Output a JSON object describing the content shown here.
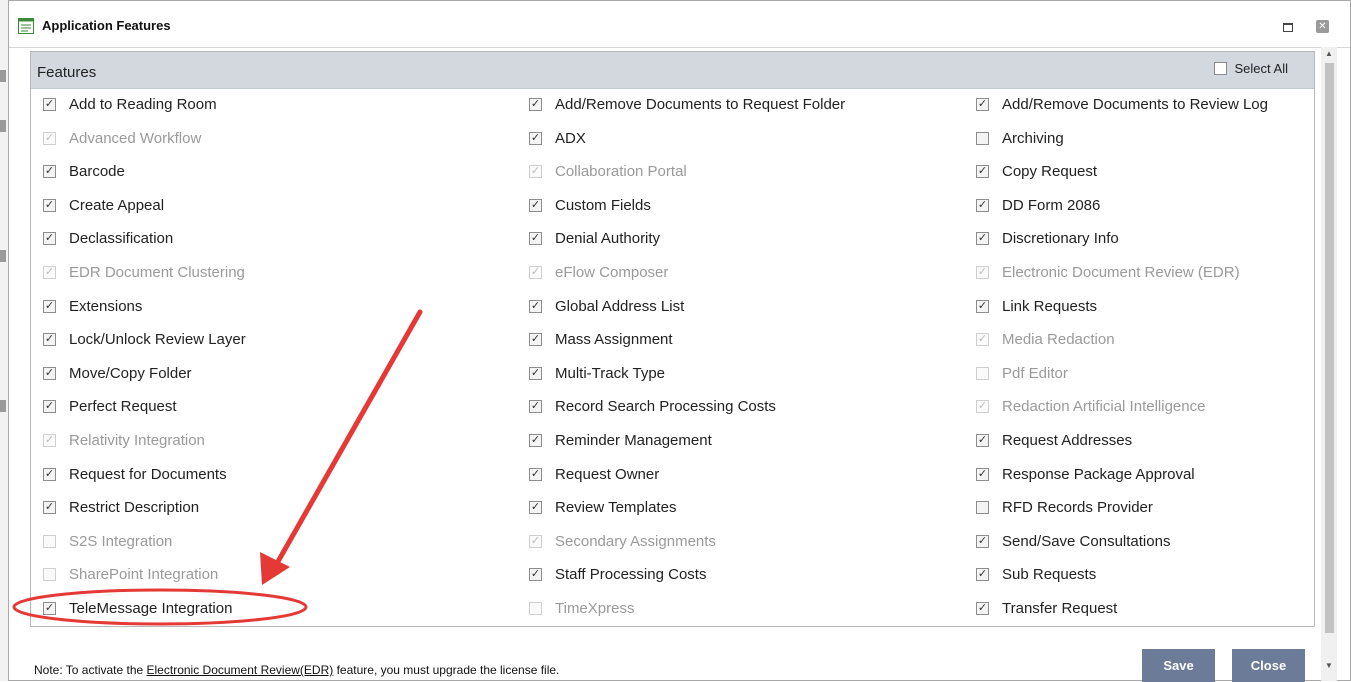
{
  "window": {
    "title": "Application Features"
  },
  "panel": {
    "header": "Features",
    "select_all_label": "Select All"
  },
  "features": {
    "col1": [
      {
        "label": "Add to Reading Room",
        "checked": true,
        "enabled": true
      },
      {
        "label": "Advanced Workflow",
        "checked": true,
        "enabled": false
      },
      {
        "label": "Barcode",
        "checked": true,
        "enabled": true
      },
      {
        "label": "Create Appeal",
        "checked": true,
        "enabled": true
      },
      {
        "label": "Declassification",
        "checked": true,
        "enabled": true
      },
      {
        "label": "EDR Document Clustering",
        "checked": true,
        "enabled": false
      },
      {
        "label": "Extensions",
        "checked": true,
        "enabled": true
      },
      {
        "label": "Lock/Unlock Review Layer",
        "checked": true,
        "enabled": true
      },
      {
        "label": "Move/Copy Folder",
        "checked": true,
        "enabled": true
      },
      {
        "label": "Perfect Request",
        "checked": true,
        "enabled": true
      },
      {
        "label": "Relativity Integration",
        "checked": true,
        "enabled": false
      },
      {
        "label": "Request for Documents",
        "checked": true,
        "enabled": true
      },
      {
        "label": "Restrict Description",
        "checked": true,
        "enabled": true
      },
      {
        "label": "S2S Integration",
        "checked": false,
        "enabled": false
      },
      {
        "label": "SharePoint Integration",
        "checked": false,
        "enabled": false
      },
      {
        "label": "TeleMessage Integration",
        "checked": true,
        "enabled": true
      }
    ],
    "col2": [
      {
        "label": "Add/Remove Documents to Request Folder",
        "checked": true,
        "enabled": true
      },
      {
        "label": "ADX",
        "checked": true,
        "enabled": true
      },
      {
        "label": "Collaboration Portal",
        "checked": true,
        "enabled": false
      },
      {
        "label": "Custom Fields",
        "checked": true,
        "enabled": true
      },
      {
        "label": "Denial Authority",
        "checked": true,
        "enabled": true
      },
      {
        "label": "eFlow Composer",
        "checked": true,
        "enabled": false
      },
      {
        "label": "Global Address List",
        "checked": true,
        "enabled": true
      },
      {
        "label": "Mass Assignment",
        "checked": true,
        "enabled": true
      },
      {
        "label": "Multi-Track Type",
        "checked": true,
        "enabled": true
      },
      {
        "label": "Record Search Processing Costs",
        "checked": true,
        "enabled": true
      },
      {
        "label": "Reminder Management",
        "checked": true,
        "enabled": true
      },
      {
        "label": "Request Owner",
        "checked": true,
        "enabled": true
      },
      {
        "label": "Review Templates",
        "checked": true,
        "enabled": true
      },
      {
        "label": "Secondary Assignments",
        "checked": true,
        "enabled": false
      },
      {
        "label": "Staff Processing Costs",
        "checked": true,
        "enabled": true
      },
      {
        "label": "TimeXpress",
        "checked": false,
        "enabled": false
      }
    ],
    "col3": [
      {
        "label": "Add/Remove Documents to Review Log",
        "checked": true,
        "enabled": true
      },
      {
        "label": "Archiving",
        "checked": false,
        "enabled": true
      },
      {
        "label": "Copy Request",
        "checked": true,
        "enabled": true
      },
      {
        "label": "DD Form 2086",
        "checked": true,
        "enabled": true
      },
      {
        "label": "Discretionary Info",
        "checked": true,
        "enabled": true
      },
      {
        "label": "Electronic Document Review (EDR)",
        "checked": true,
        "enabled": false
      },
      {
        "label": "Link Requests",
        "checked": true,
        "enabled": true
      },
      {
        "label": "Media Redaction",
        "checked": true,
        "enabled": false
      },
      {
        "label": "Pdf Editor",
        "checked": false,
        "enabled": false
      },
      {
        "label": "Redaction Artificial Intelligence",
        "checked": true,
        "enabled": false
      },
      {
        "label": "Request Addresses",
        "checked": true,
        "enabled": true
      },
      {
        "label": "Response Package Approval",
        "checked": true,
        "enabled": true
      },
      {
        "label": "RFD Records Provider",
        "checked": false,
        "enabled": true
      },
      {
        "label": "Send/Save Consultations",
        "checked": true,
        "enabled": true
      },
      {
        "label": "Sub Requests",
        "checked": true,
        "enabled": true
      },
      {
        "label": "Transfer Request",
        "checked": true,
        "enabled": true
      }
    ]
  },
  "footer": {
    "note_prefix": "Note: To activate the ",
    "note_link": "Electronic Document Review(EDR)",
    "note_suffix": " feature, you must upgrade the license file.",
    "save_label": "Save",
    "close_label": "Close"
  },
  "colors": {
    "annotation": "#e53935",
    "button": "#6b7b98",
    "header": "#d3d7de"
  }
}
